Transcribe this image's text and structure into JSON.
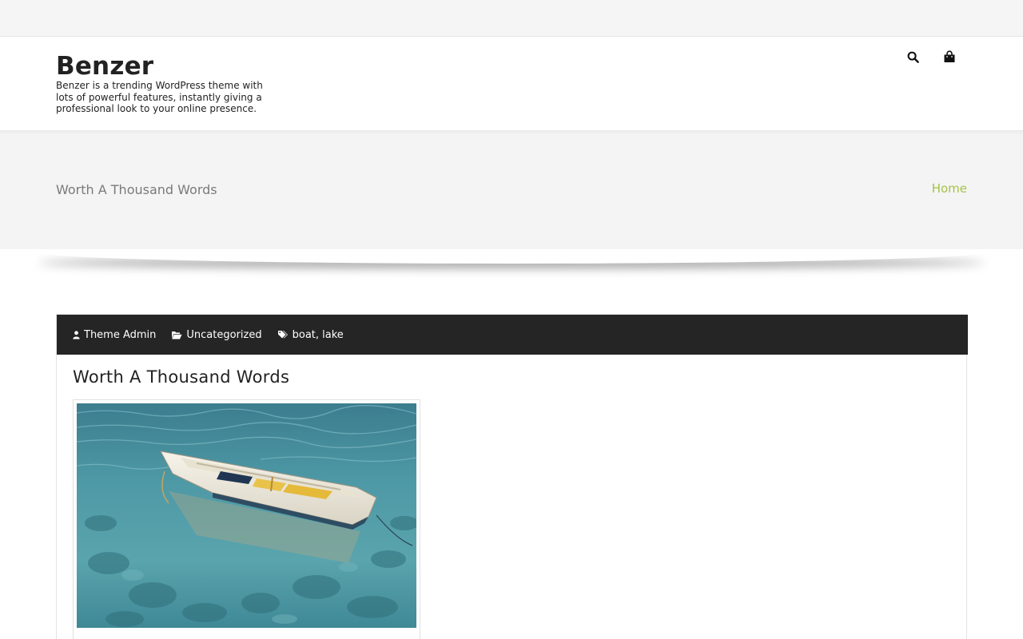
{
  "site": {
    "title": "Benzer",
    "description": "Benzer is a trending WordPress theme with lots of powerful features, instantly giving a professional look to your online presence."
  },
  "header": {
    "icons": [
      "search-icon",
      "shopping-bag-icon"
    ]
  },
  "banner": {
    "page_title": "Worth A Thousand Words",
    "breadcrumb": "Home",
    "breadcrumb_color": "#a3c244"
  },
  "post": {
    "meta": {
      "author": "Theme Admin",
      "category": "Uncategorized",
      "tags": [
        "boat",
        "lake"
      ],
      "tag_separator": ", "
    },
    "title": "Worth A Thousand Words",
    "image_alt": "Rowboat on clear lake water"
  },
  "colors": {
    "meta_bar": "#252525",
    "accent": "#a3c244"
  }
}
